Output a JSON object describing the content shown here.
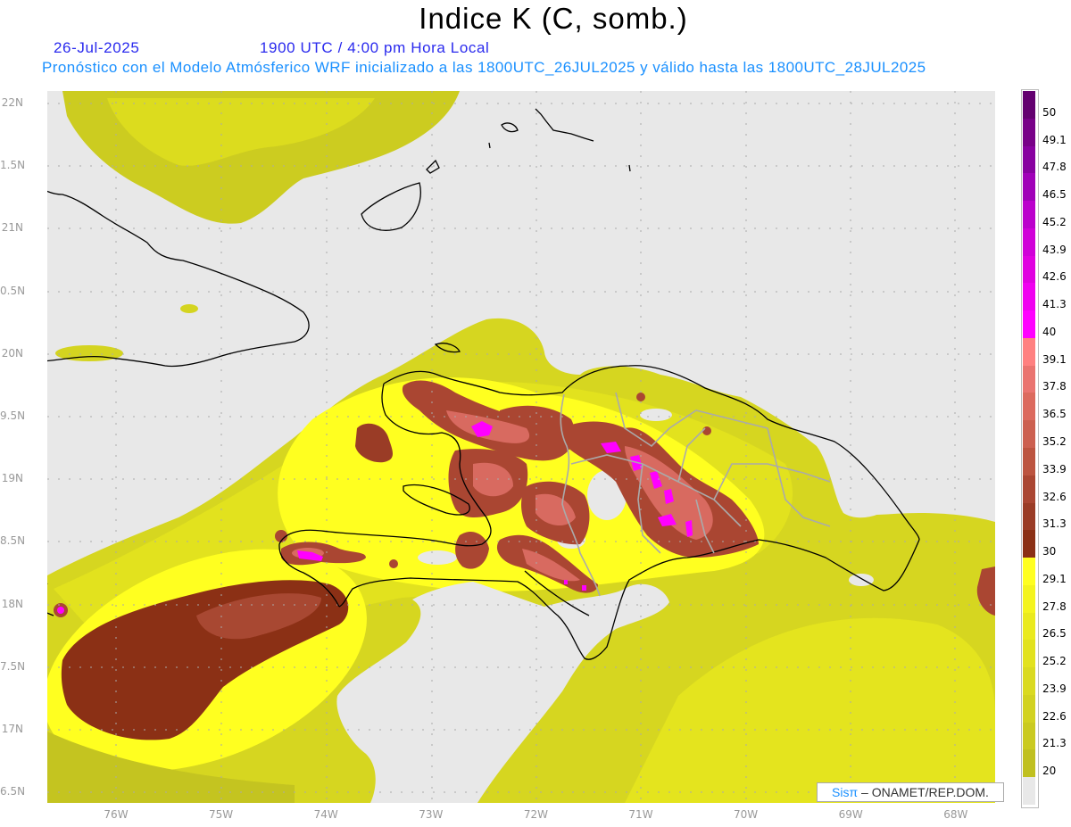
{
  "header": {
    "title": "Indice K (C, somb.)",
    "date": "26-Jul-2025",
    "time": "1900 UTC / 4:00 pm Hora Local",
    "forecast_info": "Pronóstico con el Modelo Atmósferico WRF inicializado a las 1800UTC_26JUL2025 y válido hasta las  1800UTC_28JUL2025"
  },
  "axes": {
    "lat_labels": [
      "22N",
      "1.5N",
      "21N",
      "0.5N",
      "20N",
      "9.5N",
      "19N",
      "8.5N",
      "18N",
      "7.5N",
      "17N",
      "6.5N"
    ],
    "lon_labels": [
      "76W",
      "75W",
      "74W",
      "73W",
      "72W",
      "71W",
      "70W",
      "69W",
      "68W"
    ]
  },
  "colorbar": {
    "levels": [
      "50",
      "49.1",
      "47.8",
      "46.5",
      "45.2",
      "43.9",
      "42.6",
      "41.3",
      "40",
      "39.1",
      "37.8",
      "36.5",
      "35.2",
      "33.9",
      "32.6",
      "31.3",
      "30",
      "29.1",
      "27.8",
      "26.5",
      "25.2",
      "23.9",
      "22.6",
      "21.3",
      "20"
    ],
    "colors": [
      "#640070",
      "#780088",
      "#8800a0",
      "#a000b8",
      "#bb00cc",
      "#d000d8",
      "#e000e0",
      "#f000f0",
      "#ff00ff",
      "#ff8080",
      "#ea7470",
      "#dc6a5e",
      "#cc6050",
      "#bc5440",
      "#aa4632",
      "#9a3c26",
      "#8b3015",
      "#ffff20",
      "#f4f41e",
      "#eaea1e",
      "#e2e21e",
      "#dada20",
      "#d2d220",
      "#caca20",
      "#c0c020",
      "#e8e8e8"
    ]
  },
  "credit": {
    "brand": "Sisπ",
    "text": " –  ONAMET/REP.DOM."
  }
}
